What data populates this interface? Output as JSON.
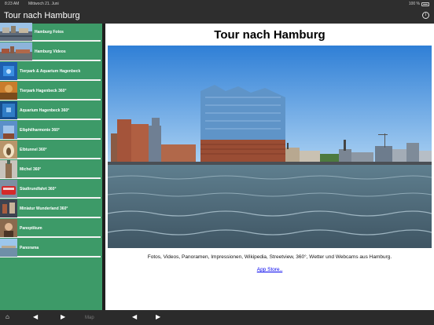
{
  "status_bar": {
    "time": "8:23 AM",
    "date": "Mittwoch 21. Juni",
    "battery": "100 %"
  },
  "nav": {
    "title": "Tour nach Hamburg"
  },
  "sidebar": {
    "items": [
      {
        "label": "Hamburg Fotos"
      },
      {
        "label": "Hamburg Videos"
      },
      {
        "label": "Tierpark & Aquarium Hagenbeck"
      },
      {
        "label": "Tierpark Hagenbeck 360°"
      },
      {
        "label": "Aquarium Hagenbeck 360°"
      },
      {
        "label": "Elbphilharmonie 360°"
      },
      {
        "label": "Elbtunnel 360°"
      },
      {
        "label": "Michel 360°"
      },
      {
        "label": "Stadtrundfahrt 360°"
      },
      {
        "label": "Miniatur Wunderland 360°"
      },
      {
        "label": "Panoptikum"
      },
      {
        "label": "Panorama"
      }
    ]
  },
  "content": {
    "heading": "Tour nach Hamburg",
    "description": "Fotos, Videos, Panoramen, Impressionen, Wikipedia, Streetview, 360°, Wetter und Webcams aus Hamburg.",
    "link": "App Store.."
  },
  "toolbar": {
    "map_label": "Map"
  },
  "colors": {
    "sidebar_bg": "#3d9a68",
    "bar_bg": "#2e2e2e",
    "link": "#0000ee"
  }
}
